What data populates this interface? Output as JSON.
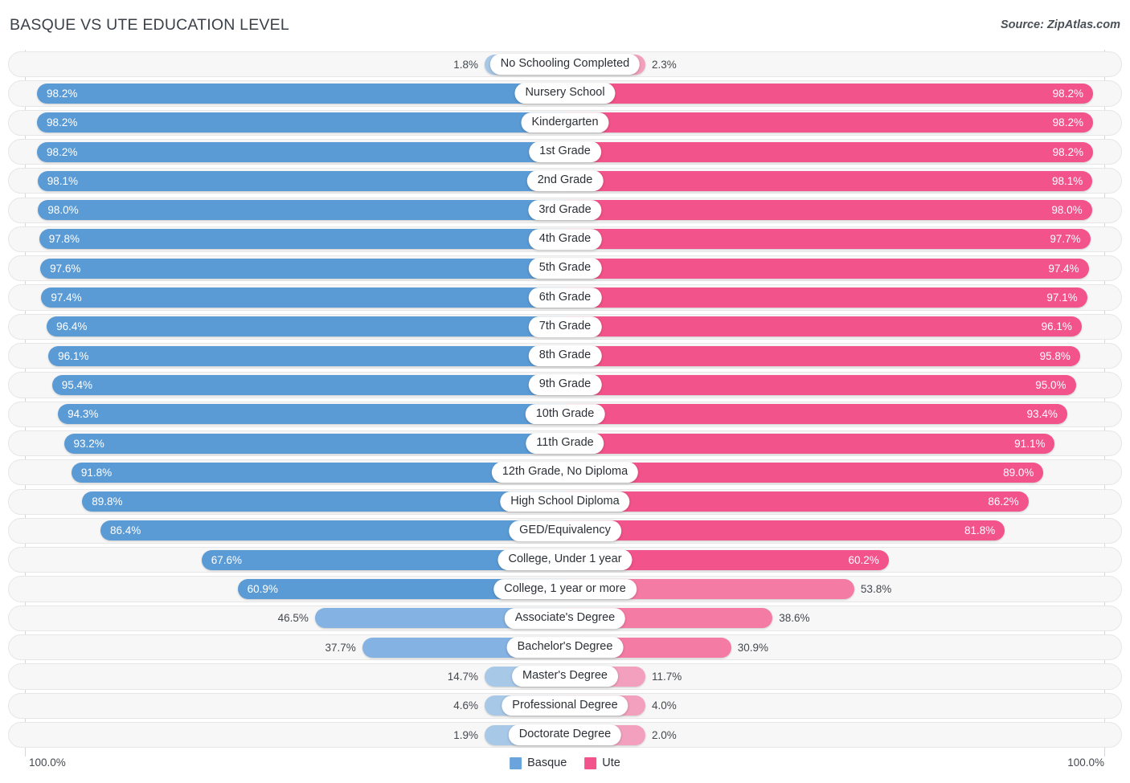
{
  "header": {
    "title": "BASQUE VS UTE EDUCATION LEVEL",
    "source": "Source: ZipAtlas.com"
  },
  "footer": {
    "axis_min_label": "100.0%",
    "axis_max_label": "100.0%",
    "legend": [
      {
        "name": "Basque",
        "color": "#6aa4dc"
      },
      {
        "name": "Ute",
        "color": "#f2538a"
      }
    ]
  },
  "colors": {
    "basque_strong": "#5b9bd5",
    "basque_mid": "#84b2e2",
    "basque_light": "#a8c8e8",
    "ute_strong": "#f2538a",
    "ute_mid": "#f47ba4",
    "ute_light": "#f2a0bd",
    "track_bg": "#f7f7f7",
    "track_border": "#e6e6e6",
    "axis_line": "#d3d6da",
    "text_dark": "#44484e"
  },
  "chart_data": {
    "type": "bar",
    "title": "BASQUE VS UTE EDUCATION LEVEL",
    "subtitle": "Source: ZipAtlas.com",
    "orientation": "horizontal-diverging",
    "xlabel": "",
    "ylabel": "",
    "xlim": [
      0,
      100
    ],
    "axis_min_label": "100.0%",
    "axis_max_label": "100.0%",
    "grid": false,
    "legend_position": "bottom-center",
    "categories": [
      "No Schooling Completed",
      "Nursery School",
      "Kindergarten",
      "1st Grade",
      "2nd Grade",
      "3rd Grade",
      "4th Grade",
      "5th Grade",
      "6th Grade",
      "7th Grade",
      "8th Grade",
      "9th Grade",
      "10th Grade",
      "11th Grade",
      "12th Grade, No Diploma",
      "High School Diploma",
      "GED/Equivalency",
      "College, Under 1 year",
      "College, 1 year or more",
      "Associate's Degree",
      "Bachelor's Degree",
      "Master's Degree",
      "Professional Degree",
      "Doctorate Degree"
    ],
    "series": [
      {
        "name": "Basque",
        "color": "#5b9bd5",
        "values": [
          1.8,
          98.2,
          98.2,
          98.2,
          98.1,
          98.0,
          97.8,
          97.6,
          97.4,
          96.4,
          96.1,
          95.4,
          94.3,
          93.2,
          91.8,
          89.8,
          86.4,
          67.6,
          60.9,
          46.5,
          37.7,
          14.7,
          4.6,
          1.9
        ],
        "labels": [
          "1.8%",
          "98.2%",
          "98.2%",
          "98.2%",
          "98.1%",
          "98.0%",
          "97.8%",
          "97.6%",
          "97.4%",
          "96.4%",
          "96.1%",
          "95.4%",
          "94.3%",
          "93.2%",
          "91.8%",
          "89.8%",
          "86.4%",
          "67.6%",
          "60.9%",
          "46.5%",
          "37.7%",
          "14.7%",
          "4.6%",
          "1.9%"
        ]
      },
      {
        "name": "Ute",
        "color": "#f2538a",
        "values": [
          2.3,
          98.2,
          98.2,
          98.2,
          98.1,
          98.0,
          97.7,
          97.4,
          97.1,
          96.1,
          95.8,
          95.0,
          93.4,
          91.1,
          89.0,
          86.2,
          81.8,
          60.2,
          53.8,
          38.6,
          30.9,
          11.7,
          4.0,
          2.0
        ],
        "labels": [
          "2.3%",
          "98.2%",
          "98.2%",
          "98.2%",
          "98.1%",
          "98.0%",
          "97.7%",
          "97.4%",
          "97.1%",
          "96.1%",
          "95.8%",
          "95.0%",
          "93.4%",
          "91.1%",
          "89.0%",
          "86.2%",
          "81.8%",
          "60.2%",
          "53.8%",
          "38.6%",
          "30.9%",
          "11.7%",
          "4.0%",
          "2.0%"
        ]
      }
    ]
  }
}
